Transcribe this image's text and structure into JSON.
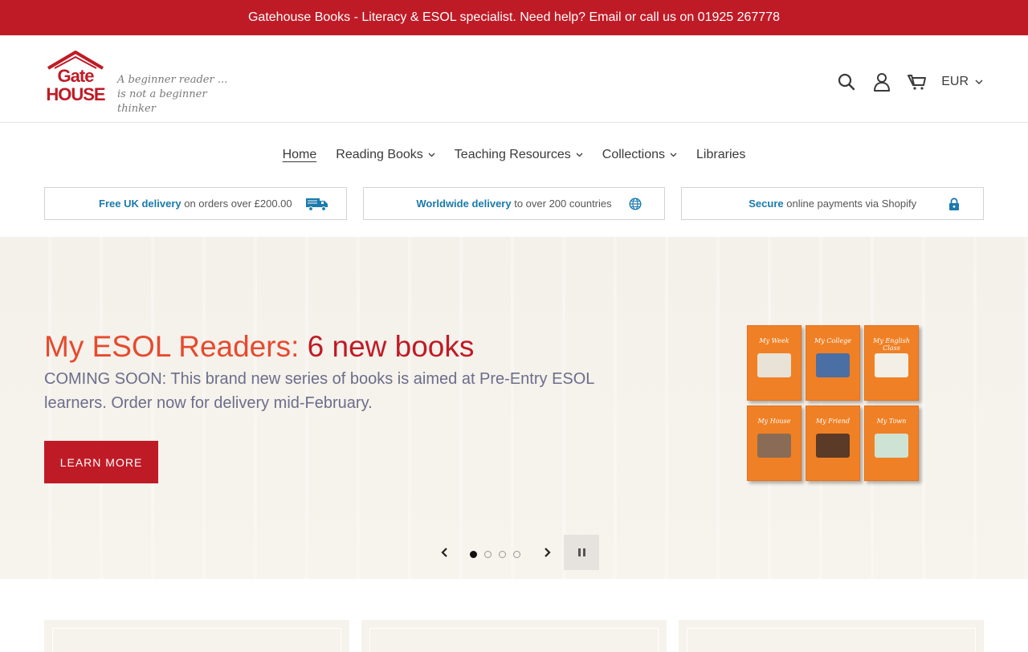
{
  "announcement": "Gatehouse Books - Literacy & ESOL specialist. Need help? Email or call us on 01925 267778",
  "logo": {
    "line1": "Gate",
    "line2": "HOUSE",
    "tagline1": "A beginner reader ...",
    "tagline2": "is not a beginner thinker"
  },
  "header": {
    "currency": "EUR"
  },
  "nav": [
    {
      "label": "Home",
      "active": true,
      "has_dropdown": false
    },
    {
      "label": "Reading Books",
      "has_dropdown": true
    },
    {
      "label": "Teaching Resources",
      "has_dropdown": true
    },
    {
      "label": "Collections",
      "has_dropdown": true
    },
    {
      "label": "Libraries",
      "has_dropdown": false
    }
  ],
  "usps": [
    {
      "strong": "Free UK delivery",
      "rest": " on orders over £200.00",
      "icon": "truck-icon"
    },
    {
      "strong": "Worldwide delivery",
      "rest": " to over 200 countries",
      "icon": "globe-icon"
    },
    {
      "strong": "Secure",
      "rest": " online payments via Shopify",
      "icon": "lock-icon"
    }
  ],
  "hero": {
    "title_part1": "My ESOL Readers:",
    "title_part2": " 6 new books",
    "text": "COMING SOON: This brand new series of books is aimed at Pre-Entry ESOL learners. Order now for delivery mid-February.",
    "button": "LEARN MORE",
    "books": [
      "My Week",
      "My College",
      "My English Class",
      "My House",
      "My Friend",
      "My Town"
    ]
  },
  "slider": {
    "slide_count": 4,
    "current": 1
  },
  "colors": {
    "brand_red": "#bf1b26",
    "usp_blue": "#1a7aad",
    "hero_orange": "#e64a2e"
  }
}
